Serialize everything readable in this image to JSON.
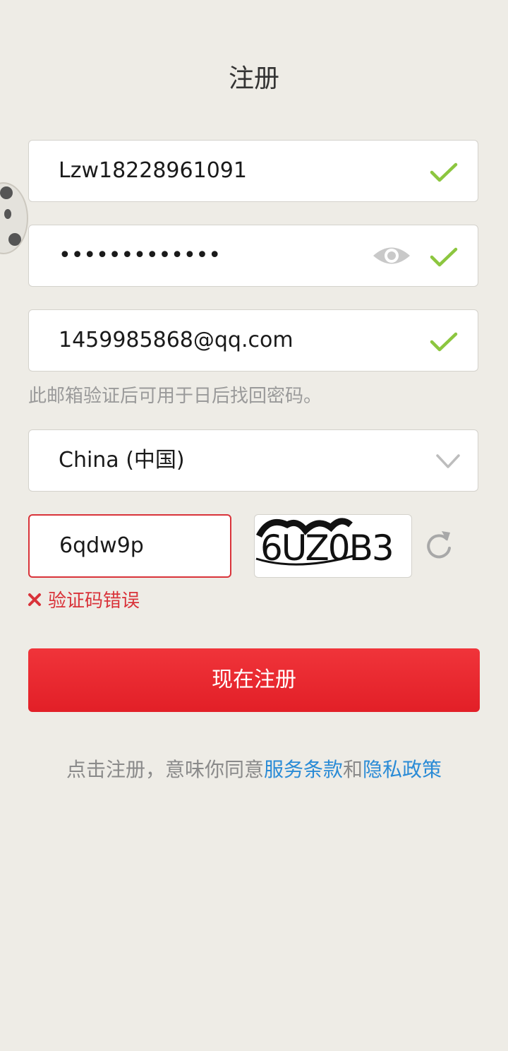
{
  "page": {
    "title": "注册"
  },
  "form": {
    "username": {
      "value": "Lzw18228961091"
    },
    "password": {
      "value": "•••••••••••••"
    },
    "email": {
      "value": "1459985868@qq.com"
    },
    "email_hint": "此邮箱验证后可用于日后找回密码。",
    "country": {
      "value": "China (中国)"
    },
    "captcha": {
      "value": "6qdw9p",
      "image_text": "6UZ0B3",
      "error": "验证码错误"
    },
    "submit_label": "现在注册"
  },
  "terms": {
    "prefix": "点击注册，意味你同意",
    "service_link": "服务条款",
    "and": "和",
    "privacy_link": "隐私政策"
  },
  "icons": {
    "valid": "check-icon",
    "show_password": "eye-icon",
    "dropdown": "chevron-down-icon",
    "refresh": "refresh-icon",
    "error": "x-icon"
  },
  "colors": {
    "background": "#eeece6",
    "accent_red": "#e21f27",
    "check_green": "#8cc63f",
    "link_blue": "#2a8bd6",
    "error_red": "#d9333a"
  }
}
